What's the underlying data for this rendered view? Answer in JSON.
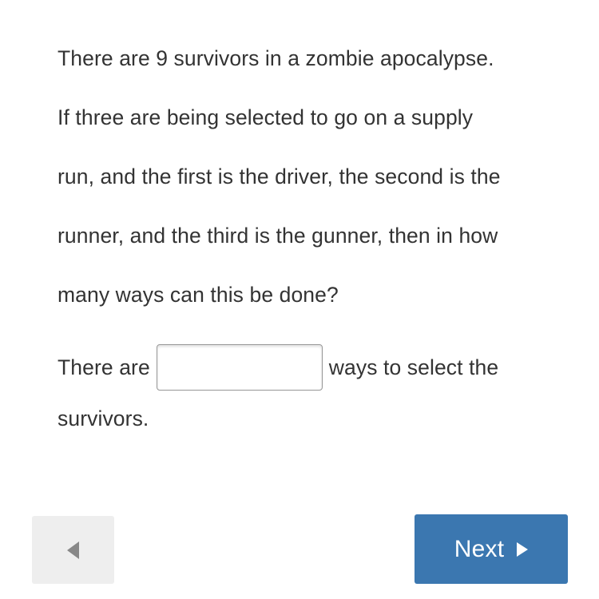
{
  "question": {
    "lines": [
      "There are 9 survivors in a zombie apocalypse.",
      "If three are being selected to go on a supply",
      "run, and the first is the driver, the second is the",
      "runner, and the third is the gunner, then in how",
      "many ways can this be done?"
    ]
  },
  "answer": {
    "prefix_text": "There are",
    "input_value": "",
    "input_placeholder": "",
    "suffix_text": "ways to select the",
    "continuation_text": "survivors."
  },
  "navigation": {
    "back_label": "",
    "back_icon": "triangle-left-icon",
    "next_label": "Next",
    "next_icon": "triangle-right-icon"
  },
  "colors": {
    "text": "#333333",
    "next_button_background": "#3b77b0",
    "next_button_text": "#ffffff",
    "back_button_background": "#eeeeee",
    "back_arrow": "#888888",
    "input_border": "#979797",
    "page_background": "#ffffff"
  }
}
